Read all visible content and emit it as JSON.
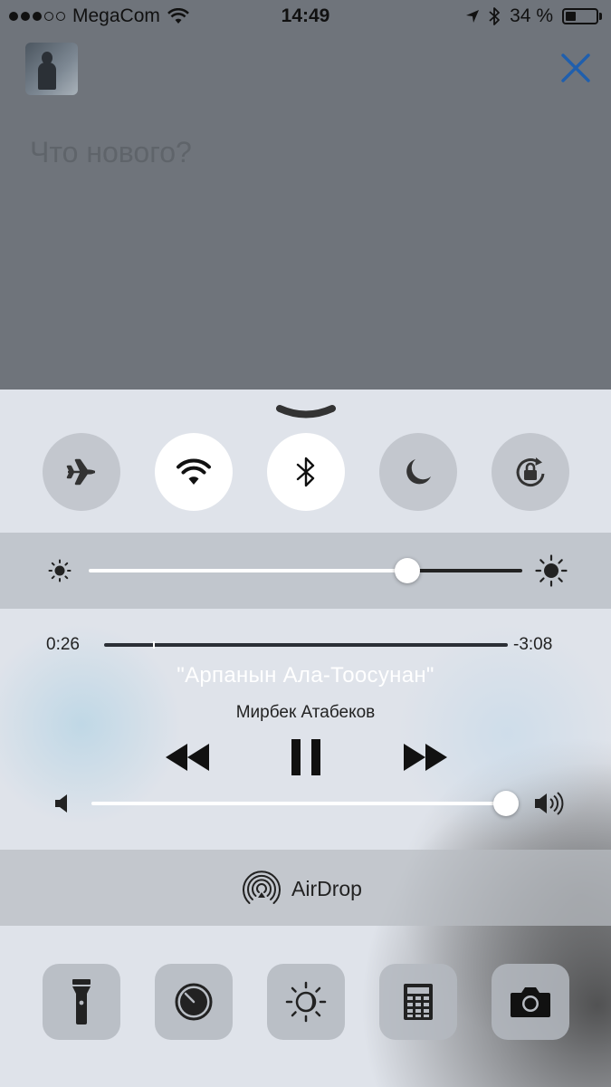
{
  "status_bar": {
    "carrier": "MegaCom",
    "time": "14:49",
    "battery_percent": "34 %",
    "battery_level": 0.34,
    "signal_bars_filled": 3,
    "signal_bars_total": 5
  },
  "compose": {
    "placeholder": "Что нового?",
    "accent_color": "#1f5fae"
  },
  "control_center": {
    "toggles": [
      {
        "name": "airplane-mode",
        "icon": "airplane-icon",
        "active": false
      },
      {
        "name": "wifi",
        "icon": "wifi-icon",
        "active": true
      },
      {
        "name": "bluetooth",
        "icon": "bluetooth-icon",
        "active": true
      },
      {
        "name": "do-not-disturb",
        "icon": "moon-icon",
        "active": false
      },
      {
        "name": "rotation-lock",
        "icon": "rotation-lock-icon",
        "active": false
      }
    ],
    "brightness_level": 0.75,
    "now_playing": {
      "elapsed": "0:26",
      "remaining": "-3:08",
      "progress": 0.12,
      "title": "\"Арпанын Ала-Тоосунан\"",
      "artist": "Мирбек Атабеков"
    },
    "volume_level": 1.0,
    "airdrop": {
      "label": "AirDrop"
    },
    "shortcuts": [
      {
        "name": "flashlight",
        "icon": "flashlight-icon"
      },
      {
        "name": "timer",
        "icon": "timer-icon"
      },
      {
        "name": "night-shift",
        "icon": "night-shift-icon"
      },
      {
        "name": "calculator",
        "icon": "calculator-icon"
      },
      {
        "name": "camera",
        "icon": "camera-icon"
      }
    ]
  }
}
